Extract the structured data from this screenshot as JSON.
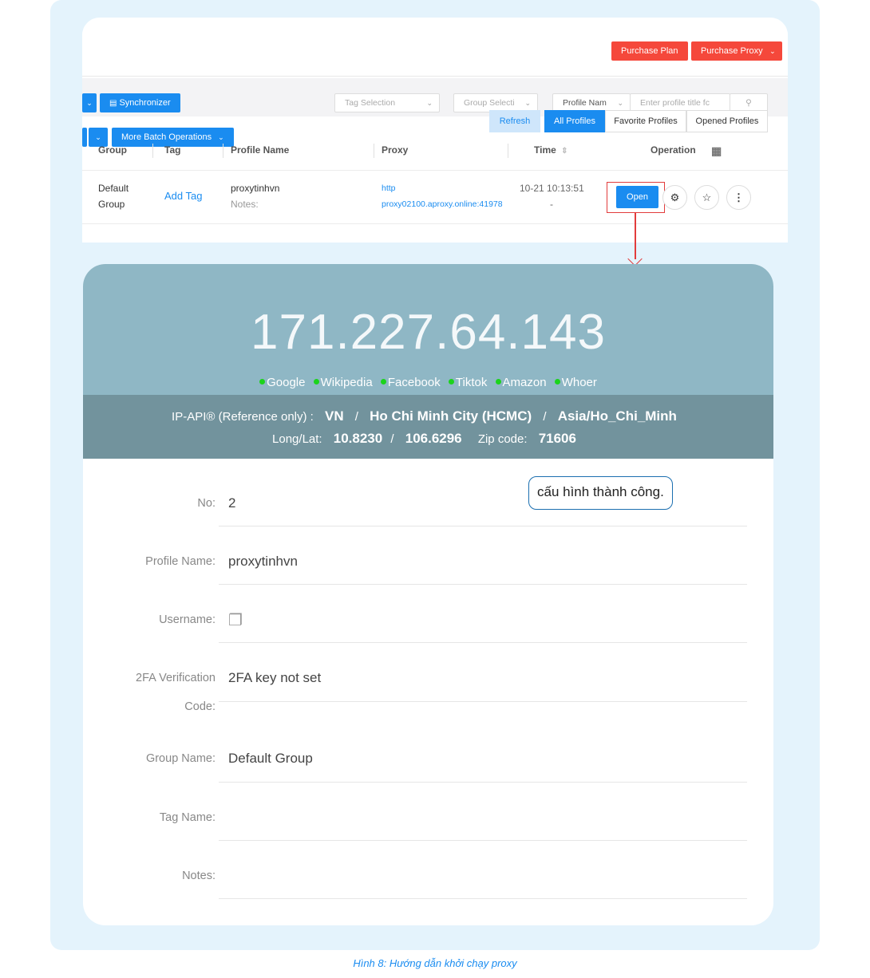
{
  "header": {
    "purchase_plan": "Purchase Plan",
    "purchase_proxy": "Purchase Proxy"
  },
  "toolbar": {
    "synchronizer": "Synchronizer",
    "tag_selection": "Tag Selection",
    "group_selection": "Group Selecti",
    "profile_name_select": "Profile Nam",
    "profile_search_placeholder": "Enter profile title fc",
    "more_batch_operations": "More Batch Operations",
    "refresh": "Refresh",
    "all_profiles": "All Profiles",
    "favorite_profiles": "Favorite Profiles",
    "opened_profiles": "Opened Profiles"
  },
  "table": {
    "headers": [
      "Group",
      "Tag",
      "Profile Name",
      "Proxy",
      "Time",
      "Operation"
    ],
    "row": {
      "group_line1": "Default",
      "group_line2": "Group",
      "tag": "Add Tag",
      "profile_name": "proxytinhvn",
      "notes_label": "Notes:",
      "proxy_type": "http",
      "proxy_address": "proxy02100.aproxy.online:41978",
      "time": "10-21 10:13:51",
      "time_sub": "-",
      "open": "Open"
    }
  },
  "ipcheck": {
    "ip": "171.227.64.143",
    "links": [
      "Google",
      "Wikipedia",
      "Facebook",
      "Tiktok",
      "Amazon",
      "Whoer"
    ],
    "source_label": "IP-API® (Reference only) :",
    "country": "VN",
    "city": "Ho Chi Minh City (HCMC)",
    "timezone": "Asia/Ho_Chi_Minh",
    "longlat_label": "Long/Lat:",
    "lat": "10.8230",
    "lon": "106.6296",
    "zip_label": "Zip code:",
    "zip": "71606",
    "slash": "/"
  },
  "details": {
    "no_label": "No:",
    "no_value": "2",
    "profile_name_label": "Profile Name:",
    "profile_name_value": "proxytinhvn",
    "username_label": "Username:",
    "twofa_label_1": "2FA Verification",
    "twofa_label_2": "Code:",
    "twofa_value": "2FA key not set",
    "group_name_label": "Group Name:",
    "group_name_value": "Default Group",
    "tag_name_label": "Tag Name:",
    "notes_label": "Notes:"
  },
  "tooltip": "cấu hình thành công.",
  "caption": "Hình 8:  Hướng dẫn khởi chạy proxy",
  "colors": {
    "accent_blue": "#1a8cf0",
    "purchase_red": "#f5483b",
    "ip_band": "#8fb7c5",
    "geo_band": "#72939d",
    "background": "#e4f3fc"
  }
}
